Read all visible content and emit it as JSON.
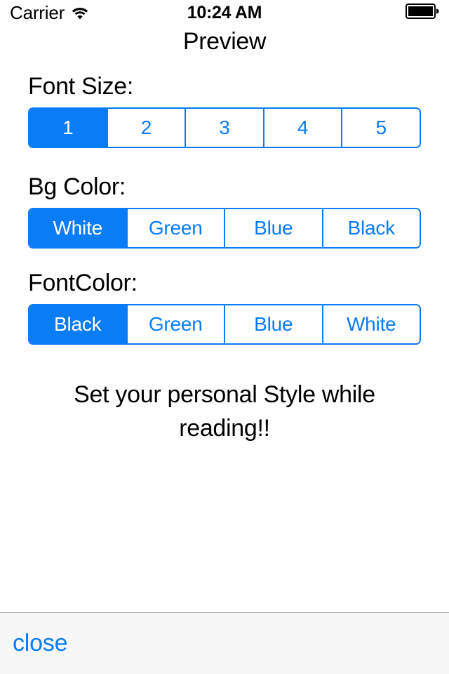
{
  "status_bar": {
    "carrier": "Carrier",
    "wifi_icon": "wifi-icon",
    "time": "10:24 AM",
    "battery_icon": "battery-full-icon"
  },
  "nav": {
    "title": "Preview"
  },
  "theme": {
    "accent_blue": "#0a7cf5",
    "text_black": "#000000",
    "toolbar_bg": "#f7f7f7",
    "toolbar_border": "#b2b2b2",
    "page_bg": "#ffffff"
  },
  "sections": {
    "font_size": {
      "label": "Font Size:",
      "options": [
        "1",
        "2",
        "3",
        "4",
        "5"
      ],
      "selected_index": 0,
      "selected_value": "1"
    },
    "bg_color": {
      "label": "Bg Color:",
      "options": [
        "White",
        "Green",
        "Blue",
        "Black"
      ],
      "selected_index": 0,
      "selected_value": "White"
    },
    "font_color": {
      "label": "FontColor:",
      "options": [
        "Black",
        "Green",
        "Blue",
        "White"
      ],
      "selected_index": 0,
      "selected_value": "Black"
    }
  },
  "preview": {
    "text": "Set your personal Style while reading!!"
  },
  "toolbar": {
    "close_label": "close"
  }
}
